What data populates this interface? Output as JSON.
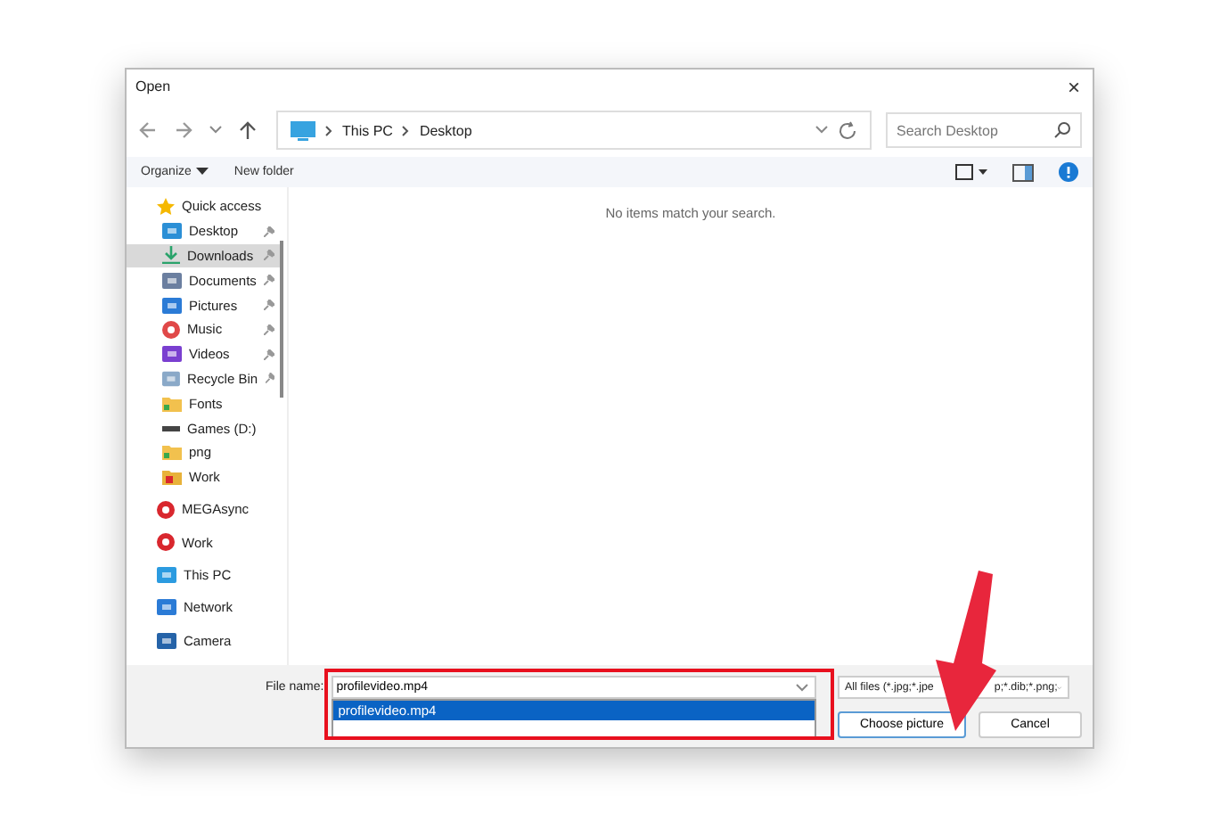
{
  "window": {
    "title": "Open",
    "close": "×"
  },
  "nav": {
    "path": [
      "This PC",
      "Desktop"
    ],
    "search": {
      "placeholder": "Search Desktop"
    }
  },
  "toolbar": {
    "organize": "Organize",
    "new_folder": "New folder"
  },
  "sidebar": {
    "items": [
      {
        "label": "Quick access",
        "kind": "star",
        "pinned": false,
        "selected": false
      },
      {
        "label": "Desktop",
        "kind": "desktop",
        "pinned": true,
        "selected": false
      },
      {
        "label": "Downloads",
        "kind": "download",
        "pinned": true,
        "selected": true
      },
      {
        "label": "Documents",
        "kind": "docs",
        "pinned": true,
        "selected": false
      },
      {
        "label": "Pictures",
        "kind": "pictures",
        "pinned": true,
        "selected": false
      },
      {
        "label": "Music",
        "kind": "music",
        "pinned": true,
        "selected": false
      },
      {
        "label": "Videos",
        "kind": "videos",
        "pinned": true,
        "selected": false
      },
      {
        "label": "Recycle Bin",
        "kind": "recycle",
        "pinned": true,
        "selected": false
      },
      {
        "label": "Fonts",
        "kind": "folder",
        "pinned": false,
        "selected": false
      },
      {
        "label": "Games (D:)",
        "kind": "drive",
        "pinned": false,
        "selected": false
      },
      {
        "label": "png",
        "kind": "folder",
        "pinned": false,
        "selected": false
      },
      {
        "label": "Work",
        "kind": "workfolder",
        "pinned": false,
        "selected": false
      },
      {
        "label": "MEGAsync",
        "kind": "app",
        "pinned": false,
        "selected": false
      },
      {
        "label": "Work",
        "kind": "app",
        "pinned": false,
        "selected": false
      },
      {
        "label": "This PC",
        "kind": "pc",
        "pinned": false,
        "selected": false
      },
      {
        "label": "Network",
        "kind": "network",
        "pinned": false,
        "selected": false
      },
      {
        "label": "Camera",
        "kind": "camera",
        "pinned": false,
        "selected": false
      }
    ]
  },
  "content": {
    "empty_message": "No items match your search."
  },
  "footer": {
    "file_name_label": "File name:",
    "file_name": "profilevideo.mp4",
    "suggestions": [
      "profilevideo.mp4"
    ],
    "filter_visible_parts": [
      "All files (*.jpg;*.jpe",
      "p;*.dib;*.png;"
    ],
    "buttons": [
      "Choose picture",
      "Cancel"
    ]
  }
}
